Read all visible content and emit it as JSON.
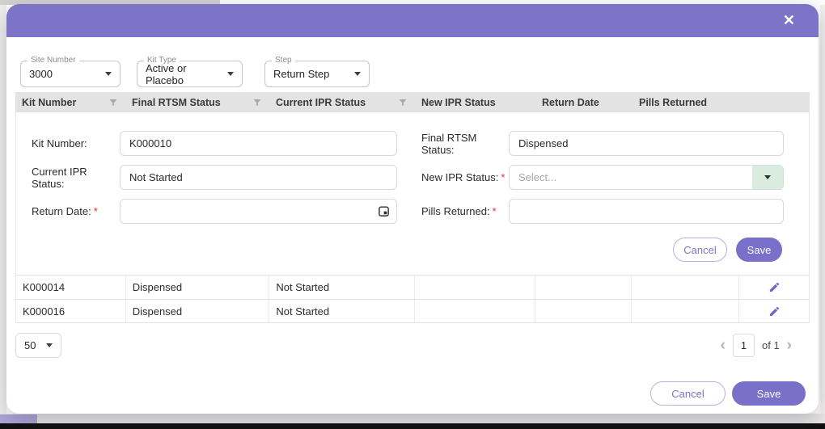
{
  "dialog": {
    "close_icon": "✕",
    "accent_color": "#7d74c8",
    "mint_color": "#d9ecdf",
    "required_color": "#e5322d",
    "required_marker": "*"
  },
  "filters": {
    "site_number": {
      "label": "Site Number",
      "value": "3000"
    },
    "kit_type": {
      "label": "Kit Type",
      "value": "Active or Placebo"
    },
    "step": {
      "label": "Step",
      "value": "Return Step"
    }
  },
  "table": {
    "headers": [
      "Kit Number",
      "Final RTSM Status",
      "Current IPR Status",
      "New IPR Status",
      "Return Date",
      "Pills Returned"
    ],
    "rows": [
      {
        "kit_number": "K000014",
        "final_rtsm_status": "Dispensed",
        "current_ipr_status": "Not Started",
        "new_ipr_status": "",
        "return_date": "",
        "pills_returned": ""
      },
      {
        "kit_number": "K000016",
        "final_rtsm_status": "Dispensed",
        "current_ipr_status": "Not Started",
        "new_ipr_status": "",
        "return_date": "",
        "pills_returned": ""
      }
    ]
  },
  "editor": {
    "kit_number_label": "Kit Number:",
    "kit_number_value": "K000010",
    "final_rtsm_label": "Final RTSM Status:",
    "final_rtsm_value": "Dispensed",
    "current_ipr_label": "Current IPR Status:",
    "current_ipr_value": "Not Started",
    "new_ipr_label": "New IPR Status:",
    "new_ipr_placeholder": "Select...",
    "return_date_label": "Return Date:",
    "return_date_value": "",
    "pills_returned_label": "Pills Returned:",
    "pills_returned_value": "",
    "cancel_label": "Cancel",
    "save_label": "Save"
  },
  "pagination": {
    "page_size": "50",
    "page": "1",
    "of_text": "of 1",
    "prev_icon": "‹",
    "next_icon": "›"
  },
  "footer": {
    "cancel_label": "Cancel",
    "save_label": "Save"
  }
}
